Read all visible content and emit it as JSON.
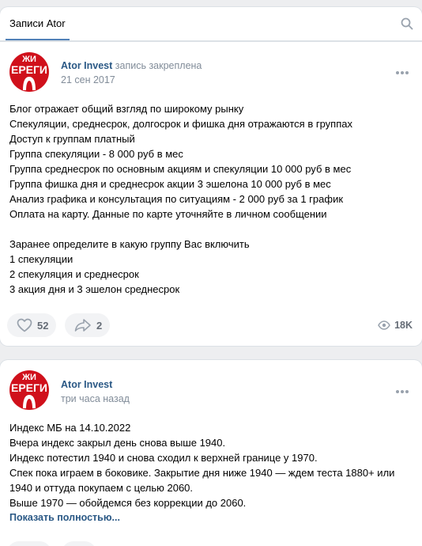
{
  "header": {
    "tab_label": "Записи Ator"
  },
  "posts": [
    {
      "author": "Ator Invest",
      "pinned_label": "запись закреплена",
      "date": "21 сен 2017",
      "avatar_text_top": "ЖИ",
      "avatar_text_main": "ЕРЕГИ",
      "lines": [
        "Блог отражает общий взгляд по широкому рынку",
        "Спекуляции, среднесрок, долгосрок и фишка дня отражаются в группах",
        "Доступ к группам платный",
        "Группа спекуляции - 8 000 руб в мес",
        "Группа среднесрок по основным акциям и спекуляции 10 000 руб в мес",
        "Группа фишка дня и среднесрок акции 3 эшелона 10 000 руб в мес",
        "Анализ графика и консультация по ситуациям - 2 000 руб за 1 график",
        "Оплата на карту. Данные по карте уточняйте в личном сообщении",
        "",
        "Заранее определите в какую группу Вас включить",
        "1 спекуляции",
        "2 спекуляция и среднесрок",
        "3 акция дня и 3 эшелон среднесрок"
      ],
      "likes": "52",
      "shares": "2",
      "views": "18K"
    },
    {
      "author": "Ator Invest",
      "date": "три часа назад",
      "avatar_text_top": "ЖИ",
      "avatar_text_main": "ЕРЕГИ",
      "lines": [
        "Индекс МБ на 14.10.2022",
        "Вчера индекс закрыл день снова выше 1940.",
        "Индекс потестил 1940 и снова сходил к верхней границе у 1970.",
        "Спек пока играем в боковике. Закрытие дня ниже 1940 — ждем теста 1880+ или",
        "1940 и оттуда покупаем с целью 2060.",
        "Выше 1970 — обойдемся без коррекции до 2060."
      ],
      "show_more": "Показать полностью..."
    }
  ],
  "colors": {
    "accent": "#5181b8",
    "link": "#2a5885",
    "secondary": "#818c99",
    "avatar_red": "#d0101b"
  }
}
